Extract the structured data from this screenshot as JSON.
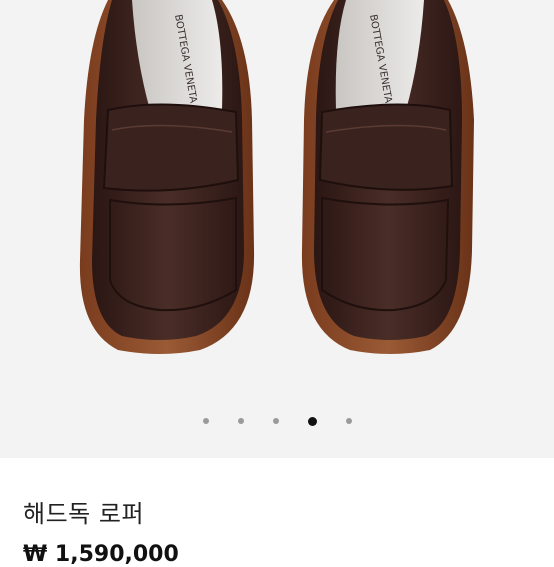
{
  "product": {
    "name": "해드독 로퍼",
    "price": "₩ 1,590,000",
    "brand_imprint": "BOTTEGA VENETA"
  },
  "carousel": {
    "total": 5,
    "current": 4,
    "image": "brown leather loafers, top view"
  },
  "colors": {
    "background": "#f3f3f3",
    "leather": "#3a2420",
    "sole": "#8a4a2a",
    "dot_active": "#111111",
    "dot_inactive": "#9a9a9a"
  }
}
